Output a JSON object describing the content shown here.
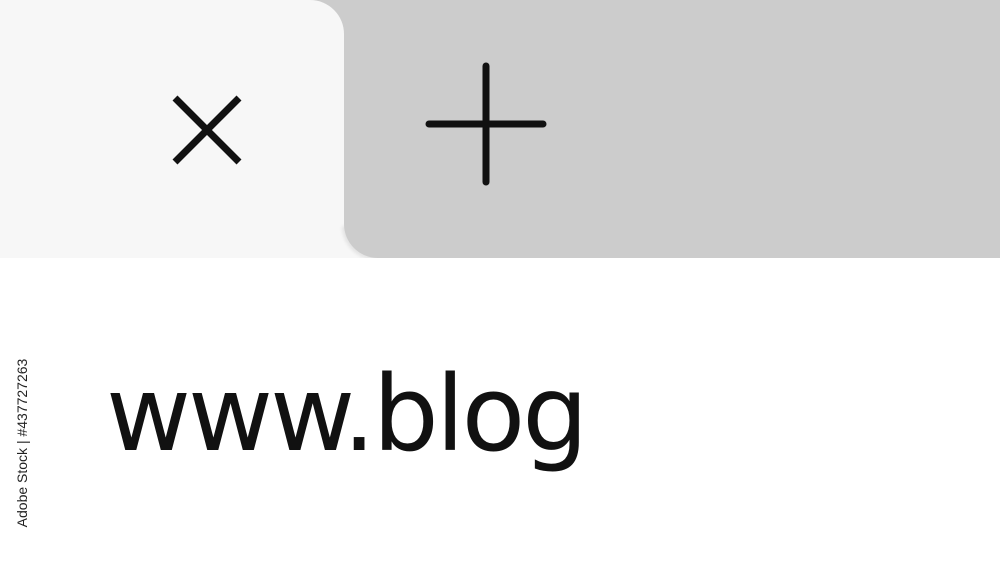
{
  "tab_bar": {
    "active_tab": {
      "close_icon": "close-icon"
    },
    "new_tab": {
      "icon": "plus-icon"
    },
    "colors": {
      "active_tab": "#f7f7f7",
      "strip": "#cccccc",
      "icon": "#111111"
    }
  },
  "address_bar": {
    "value": "www.blog"
  },
  "watermark": {
    "text": "Adobe Stock | #437727263"
  }
}
